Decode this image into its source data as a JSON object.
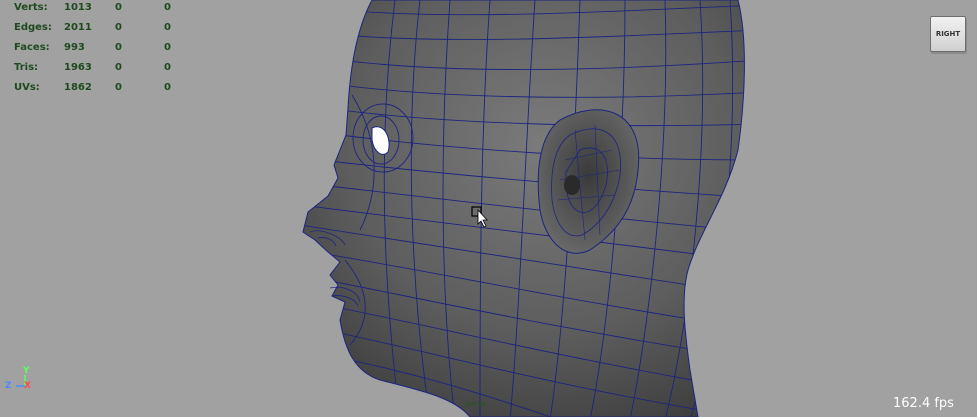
{
  "hud": {
    "rows": [
      {
        "label": "Verts:",
        "v1": "1013",
        "v2": "0",
        "v3": "0"
      },
      {
        "label": "Edges:",
        "v1": "2011",
        "v2": "0",
        "v3": "0"
      },
      {
        "label": "Faces:",
        "v1": "993",
        "v2": "0",
        "v3": "0"
      },
      {
        "label": "Tris:",
        "v1": "1963",
        "v2": "0",
        "v3": "0"
      },
      {
        "label": "UVs:",
        "v1": "1862",
        "v2": "0",
        "v3": "0"
      }
    ]
  },
  "view_cube": {
    "label": "RIGHT"
  },
  "fps": "162.4 fps",
  "axis": {
    "y": "Y",
    "z": "Z",
    "x": "X"
  },
  "camera": "persp",
  "colors": {
    "background": "#a1a1a1",
    "wireframe": "#1c2480",
    "mesh": "#5a5a5a",
    "hud_text": "#1f4a1f"
  }
}
